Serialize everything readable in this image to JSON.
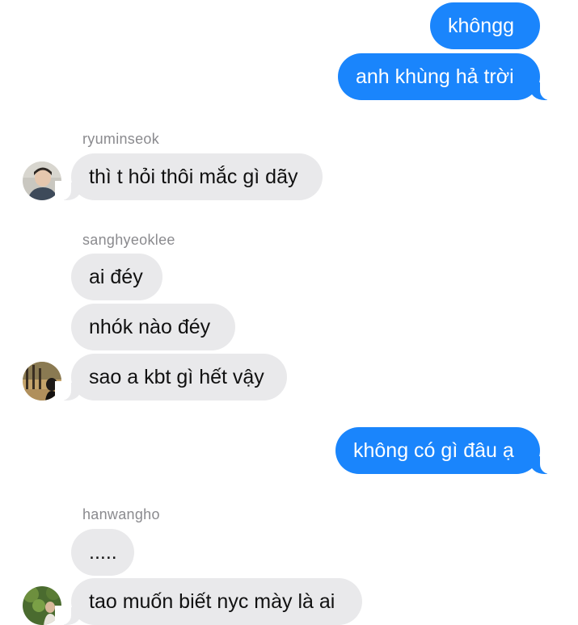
{
  "messages": {
    "sent_1": "khôngg",
    "sent_2": "anh khùng hả trời",
    "sent_3": "không có gì đâu ạ"
  },
  "groups": [
    {
      "sender": "ryuminseok",
      "messages": [
        "thì t hỏi thôi mắc gì dãy"
      ],
      "avatar_icon": "profile-photo-icon"
    },
    {
      "sender": "sanghyeoklee",
      "messages": [
        "ai đéy",
        "nhók nào đéy",
        "sao a kbt gì hết vậy"
      ],
      "avatar_icon": "profile-photo-icon"
    },
    {
      "sender": "hanwangho",
      "messages": [
        ".....",
        "tao muốn biết nyc mày là ai"
      ],
      "avatar_icon": "profile-photo-icon"
    }
  ],
  "colors": {
    "sent_bubble": "#1a85fc",
    "received_bubble": "#e9e9eb",
    "sender_name": "#8a8a8e"
  }
}
